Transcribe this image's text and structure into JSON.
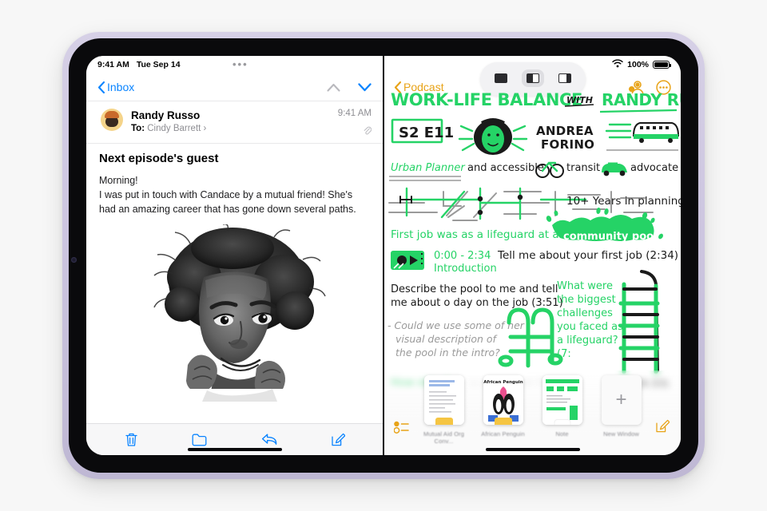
{
  "device": {
    "name": "iPad",
    "bezel_color": "#cdc6e0"
  },
  "mail": {
    "status": {
      "time": "9:41 AM",
      "date": "Tue Sep 14",
      "overflow_dots": "•••"
    },
    "nav": {
      "back_label": "Inbox",
      "up_icon": "chevron-up-icon",
      "down_icon": "chevron-down-icon"
    },
    "message": {
      "sender": "Randy Russo",
      "to_prefix": "To:",
      "to_recipient": "Cindy Barrett",
      "to_chevron": "›",
      "time": "9:41 AM",
      "attachment_icon": "paperclip-icon",
      "subject": "Next episode's guest",
      "greeting": "Morning!",
      "body": "I was put in touch with Candace by a mutual friend! She's had an amazing career that has gone down several paths.",
      "photo_alt": "Black and white portrait photo of smiling woman"
    },
    "toolbar": [
      {
        "name": "delete-button",
        "icon": "trash-icon"
      },
      {
        "name": "move-to-folder-button",
        "icon": "folder-icon"
      },
      {
        "name": "reply-button",
        "icon": "reply-arrow-icon"
      },
      {
        "name": "compose-button",
        "icon": "compose-pencil-icon"
      }
    ],
    "accent_color": "#0a84ff"
  },
  "notes": {
    "status": {
      "wifi_icon": "wifi-icon",
      "battery_percent": "100%",
      "battery_icon": "battery-full-icon"
    },
    "nav": {
      "back_label": "Podcast",
      "share_icon": "collaborate-person-icon",
      "more_icon": "more-circle-icon"
    },
    "multitasking": {
      "options": [
        {
          "name": "full-screen-button",
          "label": "Full Screen",
          "selected": false
        },
        {
          "name": "split-view-button",
          "label": "Split View",
          "selected": true
        },
        {
          "name": "slide-over-button",
          "label": "Slide Over",
          "selected": false
        }
      ]
    },
    "accent_color": "#e8a317",
    "ink_green": "#25d366",
    "ink_black": "#1a1a1a",
    "ink_grey": "#9a9a9a",
    "content": {
      "title_main": "WORK-LIFE BALANCE",
      "title_with": "WITH",
      "title_host": "RANDY RUSSO",
      "episode_badge": "S2 E11",
      "guest_name_line1": "ANDREA",
      "guest_name_line2": "FORINO",
      "guest_face_icon": "guest-portrait-doodle",
      "train_icon": "train-doodle",
      "tagline_part1": "Urban Planner",
      "tagline_part2": "and accessible",
      "bike_icon": "bicycle-doodle",
      "tagline_part3": "transit",
      "car_icon": "car-doodle",
      "tagline_part4": "advocate",
      "map_icon": "street-map-doodle",
      "years_note": "10+ Years in planning",
      "lifeguard_line": "First job was as a lifeguard at a",
      "highlight_pool": "community pool",
      "chapter_icon": "audio-clip-doodle",
      "chapter_time": "0:00 - 2:34",
      "chapter_title": "Introduction",
      "question_1": "Tell me about your first job (2:34)",
      "question_2_line1": "Describe the pool to me and tell",
      "question_2_line2": "me about o day on the job (3:51)",
      "question_3_line1": "What were",
      "question_3_line2": "the biggest",
      "question_3_line3": "challenges",
      "question_3_line4": "you faced as",
      "question_3_line5": "a lifeguard?",
      "question_3_line6": "(7:",
      "grey_note_line1": "- Could we use some of her",
      "grey_note_line2": "visual description of",
      "grey_note_line3": "the pool in the intro?",
      "question_4_start": "How else d",
      "question_4_end": "ol? (9:33)",
      "chair_icon": "lifeguard-chair-doodle",
      "ladder_icon": "pool-ladder-doodle"
    },
    "shelf": {
      "items": [
        {
          "name": "shelf-item-mutual-aid",
          "label": "Mutual Aid\nOrg Conv...",
          "thumb": "note-thumb-text"
        },
        {
          "name": "shelf-item-african-penguin",
          "label": "African\nPenguin",
          "thumb": "note-thumb-penguin"
        },
        {
          "name": "shelf-item-note",
          "label": "Note",
          "thumb": "note-thumb-green"
        },
        {
          "name": "shelf-item-new-window",
          "label": "New\nWindow",
          "thumb": "plus-icon"
        }
      ]
    },
    "bottom_left_icon": "notes-list-icon",
    "bottom_right_icon": "new-note-compose-icon"
  }
}
